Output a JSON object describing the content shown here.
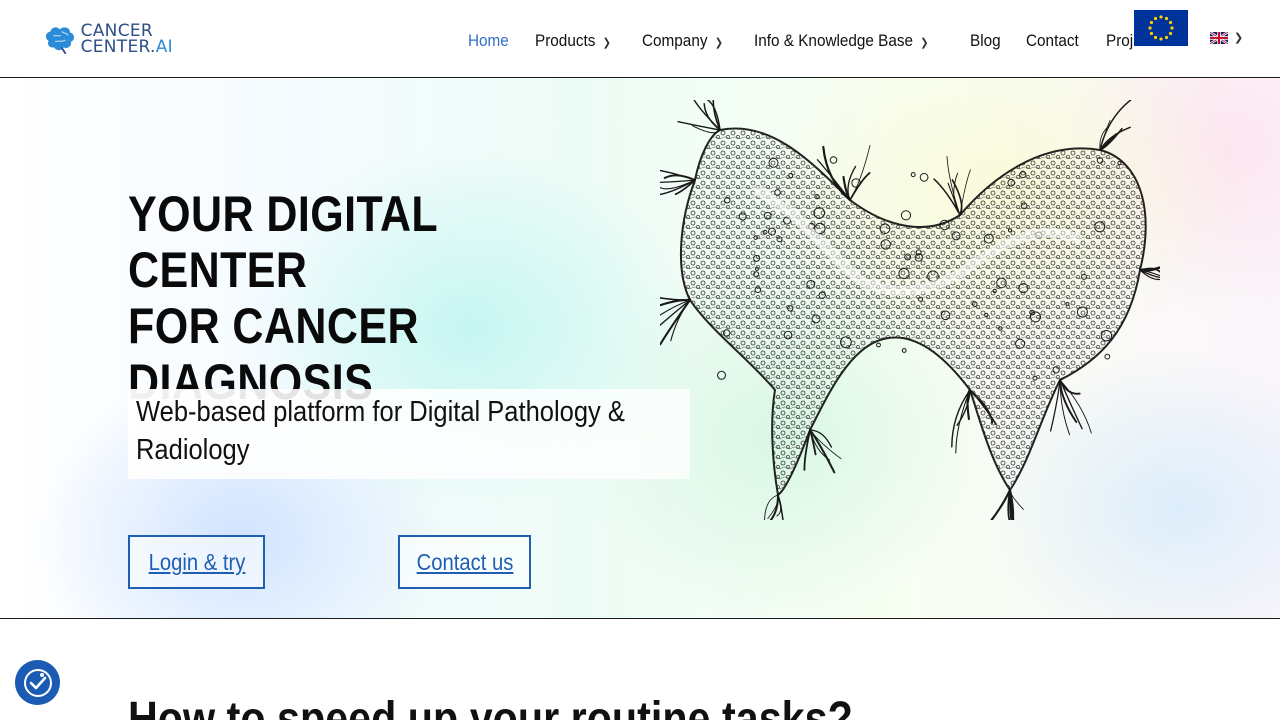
{
  "brand": {
    "logo_line1": "CANCER",
    "logo_line2_main": "CENTER.",
    "logo_line2_accent": "AI",
    "primary_color": "#2c4f86",
    "accent_color": "#2a8bd8"
  },
  "nav": {
    "items": [
      {
        "label": "Home",
        "active": true,
        "has_dropdown": false
      },
      {
        "label": "Products",
        "active": false,
        "has_dropdown": true
      },
      {
        "label": "Company",
        "active": false,
        "has_dropdown": true
      },
      {
        "label": "Info & Knowledge Base",
        "active": false,
        "has_dropdown": true
      },
      {
        "label": "Blog",
        "active": false,
        "has_dropdown": false
      },
      {
        "label": "Contact",
        "active": false,
        "has_dropdown": false
      },
      {
        "label": "Projects",
        "active": false,
        "has_dropdown": false
      }
    ],
    "active_color": "#2f6fc4",
    "chevron_icon": "chevron-down-icon",
    "language_icon": "uk-flag-icon",
    "eu_icon": "eu-flag-icon"
  },
  "hero": {
    "title_line1": "YOUR DIGITAL CENTER",
    "title_line2": "FOR CANCER",
    "title_line3": "DIAGNOSIS",
    "subtitle_line1": "Web-based platform for Digital Pathology &",
    "subtitle_line2": "Radiology",
    "login_button": "Login & try",
    "contact_button": "Contact us",
    "button_color": "#1e5fb4",
    "illustration_icon": "cancer-cell-illustration"
  },
  "section": {
    "heading": "How to speed up your routine tasks?"
  },
  "accessibility": {
    "icon": "accessibility-checkmark-icon",
    "color": "#1b5bb3"
  }
}
